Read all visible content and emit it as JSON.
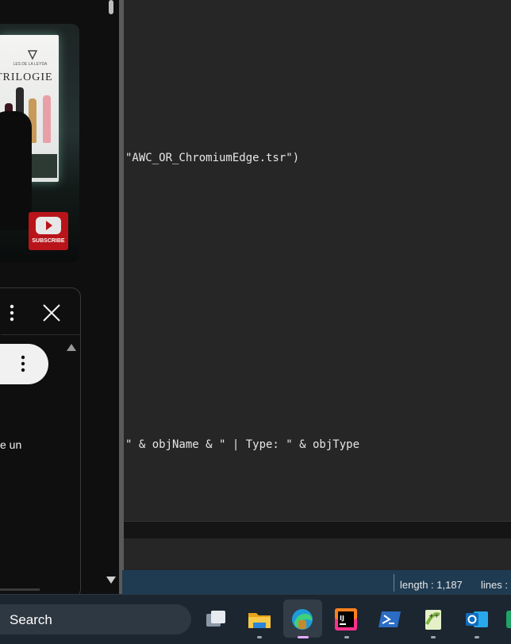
{
  "video": {
    "brand_small": "LES\nDE LA LEYDA",
    "brand_title": "TRILOGIE",
    "subscribe_label": "SUBSCRIBE"
  },
  "popup": {
    "text": "e un"
  },
  "editor": {
    "line1": "\"AWC_OR_ChromiumEdge.tsr\")",
    "line2": "\" & objName & \" | Type: \" & objType"
  },
  "status_bar": {
    "length": "length : 1,187",
    "lines": "lines :"
  },
  "taskbar": {
    "search_label": "Search",
    "icons": [
      "task-view-icon",
      "file-explorer-icon",
      "edge-icon",
      "intellij-icon",
      "powershell-icon",
      "notepad-plus-plus-icon",
      "outlook-icon"
    ]
  },
  "colors": {
    "editor_bg": "#262626",
    "status_bar": "#1f3b52",
    "taskbar": "#1c2630",
    "subscribe_red": "#b8141a"
  }
}
